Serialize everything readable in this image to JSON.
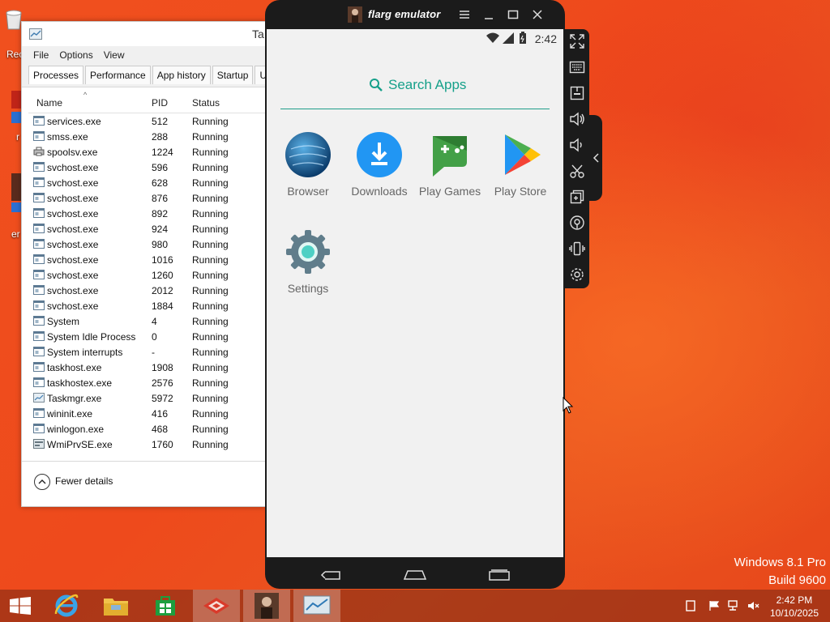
{
  "desktop": {
    "icons": [
      {
        "name": "recycle-bin",
        "label": "Rec"
      },
      {
        "name": "shortcut-1",
        "label": "r"
      },
      {
        "name": "shortcut-2",
        "label": "er"
      }
    ],
    "watermark": {
      "line1": "Windows 8.1 Pro",
      "line2": "Build 9600"
    }
  },
  "task_manager": {
    "title": "Ta",
    "menu": [
      "File",
      "Options",
      "View"
    ],
    "tabs": [
      "Processes",
      "Performance",
      "App history",
      "Startup",
      "Use"
    ],
    "columns": {
      "name": "Name",
      "pid": "PID",
      "status": "Status"
    },
    "rows": [
      {
        "name": "services.exe",
        "pid": "512",
        "status": "Running",
        "icon": "process-icon"
      },
      {
        "name": "smss.exe",
        "pid": "288",
        "status": "Running",
        "icon": "process-icon"
      },
      {
        "name": "spoolsv.exe",
        "pid": "1224",
        "status": "Running",
        "icon": "printer-icon"
      },
      {
        "name": "svchost.exe",
        "pid": "596",
        "status": "Running",
        "icon": "process-icon"
      },
      {
        "name": "svchost.exe",
        "pid": "628",
        "status": "Running",
        "icon": "process-icon"
      },
      {
        "name": "svchost.exe",
        "pid": "876",
        "status": "Running",
        "icon": "process-icon"
      },
      {
        "name": "svchost.exe",
        "pid": "892",
        "status": "Running",
        "icon": "process-icon"
      },
      {
        "name": "svchost.exe",
        "pid": "924",
        "status": "Running",
        "icon": "process-icon"
      },
      {
        "name": "svchost.exe",
        "pid": "980",
        "status": "Running",
        "icon": "process-icon"
      },
      {
        "name": "svchost.exe",
        "pid": "1016",
        "status": "Running",
        "icon": "process-icon"
      },
      {
        "name": "svchost.exe",
        "pid": "1260",
        "status": "Running",
        "icon": "process-icon"
      },
      {
        "name": "svchost.exe",
        "pid": "2012",
        "status": "Running",
        "icon": "process-icon"
      },
      {
        "name": "svchost.exe",
        "pid": "1884",
        "status": "Running",
        "icon": "process-icon"
      },
      {
        "name": "System",
        "pid": "4",
        "status": "Running",
        "icon": "process-icon"
      },
      {
        "name": "System Idle Process",
        "pid": "0",
        "status": "Running",
        "icon": "process-icon"
      },
      {
        "name": "System interrupts",
        "pid": "-",
        "status": "Running",
        "icon": "process-icon"
      },
      {
        "name": "taskhost.exe",
        "pid": "1908",
        "status": "Running",
        "icon": "process-icon"
      },
      {
        "name": "taskhostex.exe",
        "pid": "2576",
        "status": "Running",
        "icon": "process-icon"
      },
      {
        "name": "Taskmgr.exe",
        "pid": "5972",
        "status": "Running",
        "icon": "taskmgr-icon"
      },
      {
        "name": "wininit.exe",
        "pid": "416",
        "status": "Running",
        "icon": "process-icon"
      },
      {
        "name": "winlogon.exe",
        "pid": "468",
        "status": "Running",
        "icon": "process-icon"
      },
      {
        "name": "WmiPrvSE.exe",
        "pid": "1760",
        "status": "Running",
        "icon": "wmi-icon"
      }
    ],
    "fewer_details": "Fewer details"
  },
  "emulator": {
    "title": "flarg emulator",
    "status_time": "2:42",
    "search_placeholder": "Search Apps",
    "apps": [
      {
        "label": "Browser",
        "icon": "browser-icon"
      },
      {
        "label": "Downloads",
        "icon": "downloads-icon"
      },
      {
        "label": "Play Games",
        "icon": "play-games-icon"
      },
      {
        "label": "Play Store",
        "icon": "play-store-icon"
      },
      {
        "label": "Settings",
        "icon": "settings-icon"
      }
    ],
    "side_toolbar": [
      "fullscreen-icon",
      "keyboard-icon",
      "apk-icon",
      "volume-up-icon",
      "volume-down-icon",
      "scissors-icon",
      "multi-instance-icon",
      "location-icon",
      "shake-icon",
      "gear-icon"
    ]
  },
  "taskbar": {
    "items": [
      "start-button",
      "internet-explorer",
      "file-explorer",
      "store",
      "app-red",
      "flarg-emulator",
      "task-manager"
    ],
    "clock_time": "2:42 PM",
    "clock_date": "10/10/2025"
  },
  "colors": {
    "accent_teal": "#16a08a",
    "desktop_orange": "#ee4a1c"
  }
}
